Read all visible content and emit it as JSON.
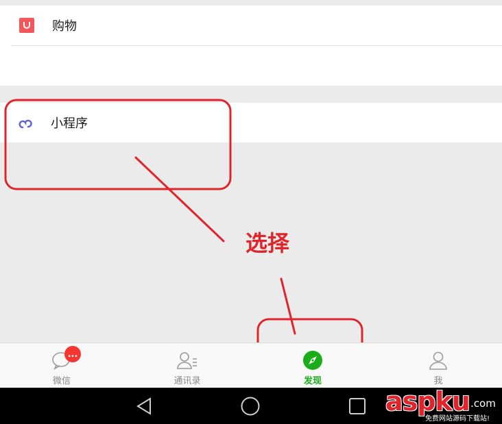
{
  "list": {
    "shopping_label": "购物",
    "miniprogram_label": "小程序"
  },
  "tabbar": {
    "tabs": [
      {
        "label": "微信",
        "icon": "chat-bubble-icon",
        "badge": "..."
      },
      {
        "label": "通讯录",
        "icon": "contacts-icon"
      },
      {
        "label": "发现",
        "icon": "compass-icon",
        "active": true
      },
      {
        "label": "我",
        "icon": "person-icon"
      }
    ]
  },
  "annotation": {
    "text": "选择"
  },
  "watermark": {
    "main": "aspku",
    "suffix": ".com",
    "sub": "免费网站源码下载站!"
  },
  "colors": {
    "accent_green": "#1aad19",
    "annotation_red": "#e0242b",
    "shopping_icon": "#f2585b",
    "miniprogram_icon": "#6467c9",
    "badge_red": "#f43530"
  }
}
